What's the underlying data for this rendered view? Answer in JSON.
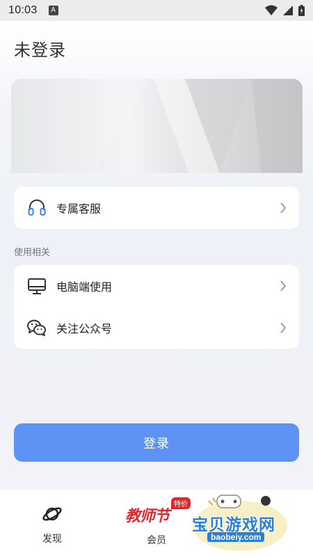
{
  "status_bar": {
    "time": "10:03",
    "notification_letter": "A",
    "icons": [
      "wifi-icon",
      "signal-icon",
      "battery-icon"
    ]
  },
  "page": {
    "title": "未登录"
  },
  "service_card": {
    "items": [
      {
        "icon": "headset-icon",
        "label": "专属客服"
      }
    ]
  },
  "usage_section": {
    "heading": "使用相关",
    "items": [
      {
        "icon": "monitor-icon",
        "label": "电脑端使用"
      },
      {
        "icon": "wechat-icon",
        "label": "关注公众号"
      }
    ]
  },
  "login": {
    "label": "登录"
  },
  "tabbar": {
    "tabs": [
      {
        "icon": "planet-icon",
        "label": "发现"
      },
      {
        "label": "会员",
        "promo_text": "教师节",
        "promo_badge": "特价"
      }
    ]
  },
  "watermark": {
    "title": "宝贝游戏网",
    "url": "baobeiy.com"
  },
  "colors": {
    "accent": "#5c93f4",
    "promo_red": "#e3262b",
    "watermark_blue": "#2a7fd8"
  }
}
